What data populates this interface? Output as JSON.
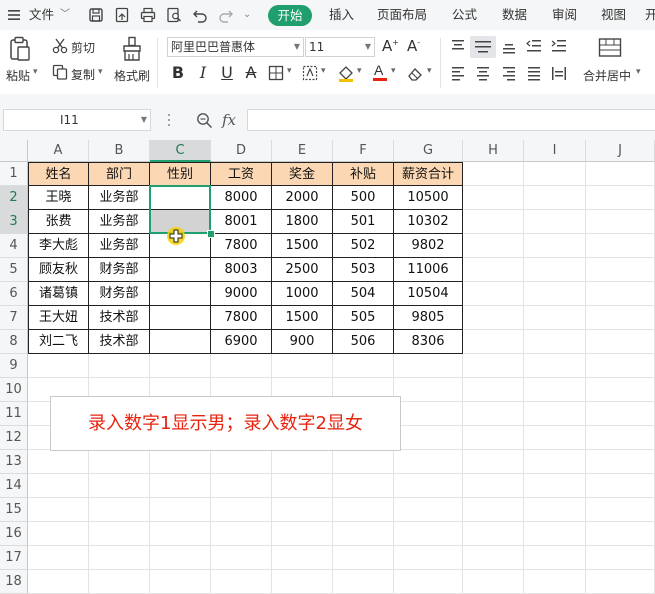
{
  "menubar": {
    "file_label": "文件",
    "tabs": [
      "开始",
      "插入",
      "页面布局",
      "公式",
      "数据",
      "审阅",
      "视图",
      "开"
    ]
  },
  "ribbon": {
    "paste_label": "粘贴",
    "cut_label": "剪切",
    "copy_label": "复制",
    "format_painter_label": "格式刷",
    "font_name": "阿里巴巴普惠体",
    "font_size": "11",
    "merge_label": "合并居中"
  },
  "formula_bar": {
    "name_box": "I11",
    "fx_label": "fx",
    "formula": ""
  },
  "sheet": {
    "columns": [
      "A",
      "B",
      "C",
      "D",
      "E",
      "F",
      "G",
      "H",
      "I",
      "J"
    ],
    "rows": [
      "1",
      "2",
      "3",
      "4",
      "5",
      "6",
      "7",
      "8",
      "9",
      "10",
      "11",
      "12",
      "13",
      "14",
      "15",
      "16",
      "17",
      "18"
    ],
    "header": [
      "姓名",
      "部门",
      "性别",
      "工资",
      "奖金",
      "补贴",
      "薪资合计"
    ],
    "data": [
      [
        "王晓",
        "业务部",
        "",
        "8000",
        "2000",
        "500",
        "10500"
      ],
      [
        "张费",
        "业务部",
        "",
        "8001",
        "1800",
        "501",
        "10302"
      ],
      [
        "李大彪",
        "业务部",
        "",
        "7800",
        "1500",
        "502",
        "9802"
      ],
      [
        "顾友秋",
        "财务部",
        "",
        "8003",
        "2500",
        "503",
        "11006"
      ],
      [
        "诸葛镇",
        "财务部",
        "",
        "9000",
        "1000",
        "504",
        "10504"
      ],
      [
        "王大妞",
        "技术部",
        "",
        "7800",
        "1500",
        "505",
        "9805"
      ],
      [
        "刘二飞",
        "技术部",
        "",
        "6900",
        "900",
        "506",
        "8306"
      ]
    ],
    "note": "录入数字1显示男；录入数字2显女"
  },
  "colors": {
    "accent": "#1f9e6e",
    "header_fill": "#fbd7b4",
    "note_text": "#e8230f"
  }
}
